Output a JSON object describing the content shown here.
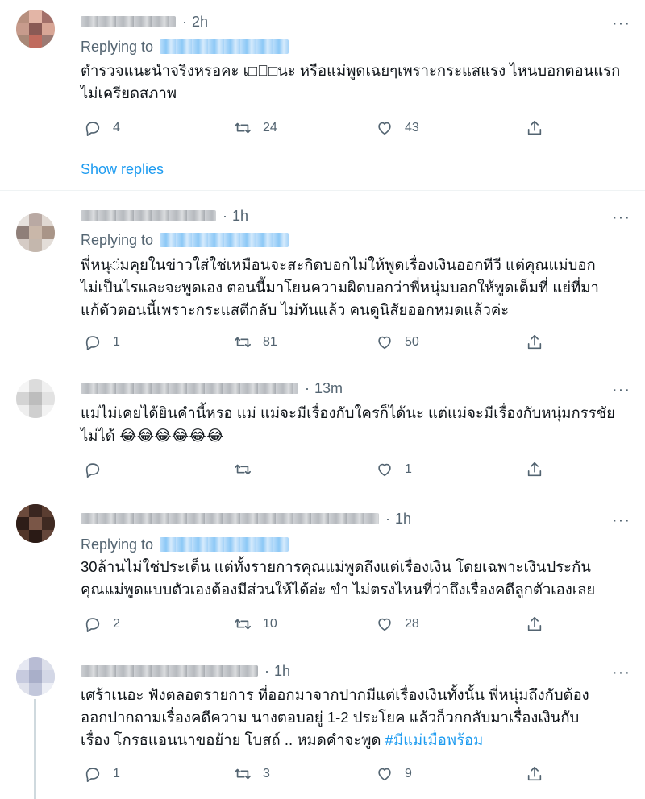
{
  "tweets": [
    {
      "time": "2h",
      "replying_to": "Replying to",
      "text": "ตำรวจแนะนำจริงหรอคะ เ□ั□นะ หรือแม่พูดเฉยๆเพราะกระแสแรง ไหนบอกตอนแรก\nไม่เครียดสภาพ",
      "replies": "4",
      "retweets": "24",
      "likes": "43",
      "show_replies": "Show replies"
    },
    {
      "time": "1h",
      "replying_to": "Replying to",
      "text": "พี่หนุ◌่มคุยในข่าวใส่ใช่เหมือนจะสะกิดบอกไม่ให้พูดเรื่องเงินออกทีวี แต่คุณแม่บอก\nไม่เป็นไรและจะพูดเอง  ตอนนี้มาโยนความผิดบอกว่าพี่หนุ่มบอกให้พูดเต็มที่ แย่ที่มา\nแก้ตัวตอนนี้เพราะกระแสตีกลับ ไม่ทันแล้ว คนดูนิสัยออกหมดแล้วค่ะ",
      "replies": "1",
      "retweets": "81",
      "likes": "50"
    },
    {
      "time": "13m",
      "text": "แม่ไม่เคยได้ยินคำนี้หรอ แม่ แม่จะมีเรื่องกับใครก็ได้นะ แต่แม่จะมีเรื่องกับหนุ่มกรรชัย\nไม่ได้ 😂😂😂😂😂😂",
      "replies": "",
      "retweets": "",
      "likes": "1"
    },
    {
      "time": "1h",
      "replying_to": "Replying to",
      "text": "30ล้านไม่ใช่ประเด็น แต่ทั้งรายการคุณแม่พูดถึงแต่เรื่องเงิน โดยเฉพาะเงินประกัน\nคุณแม่พูดแบบตัวเองต้องมีส่วนให้ได้อ่ะ ขำ ไม่ตรงไหนที่ว่าถึงเรื่องคดีลูกตัวเองเลย",
      "replies": "2",
      "retweets": "10",
      "likes": "28"
    },
    {
      "time": "1h",
      "text": "เศร้าเนอะ  ฟังตลอดรายการ ที่ออกมาจากปากมีแต่เรื่องเงินทั้งนั้น  พี่หนุ่มถึงกับต้อง\nออกปากถามเรื่องคดีความ นางตอบอยู่ 1-2 ประโยค แล้วก็วกกลับมาเรื่องเงินกับ\nเรื่อง โกรธแอนนาขอย้าย โบสถ์  .. หมดคำจะพูด",
      "hashtag": "#มีแม่เมื่อพร้อม",
      "replies": "1",
      "retweets": "3",
      "likes": "9"
    }
  ],
  "icons": [
    "reply-icon",
    "retweet-icon",
    "like-icon",
    "share-icon",
    "more-icon"
  ],
  "colors": {
    "link": "#1d9bf0",
    "secondary": "#536471",
    "text": "#0f1419"
  }
}
